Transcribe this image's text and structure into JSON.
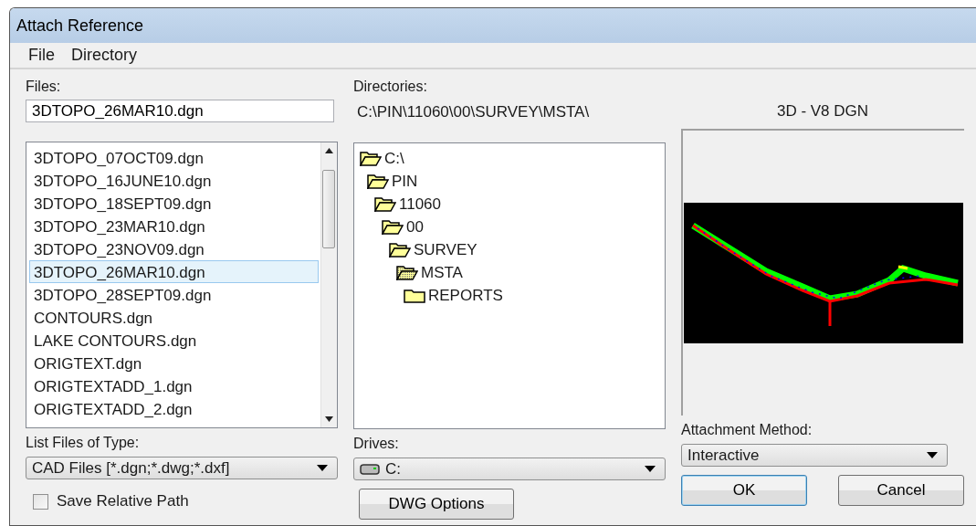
{
  "window": {
    "title": "Attach Reference"
  },
  "menu": [
    {
      "label": "File"
    },
    {
      "label": "Directory"
    }
  ],
  "files": {
    "label": "Files:",
    "value": "3DTOPO_26MAR10.dgn",
    "items": [
      {
        "name": "3DTOPO_07OCT09.dgn",
        "selected": false
      },
      {
        "name": "3DTOPO_16JUNE10.dgn",
        "selected": false
      },
      {
        "name": "3DTOPO_18SEPT09.dgn",
        "selected": false
      },
      {
        "name": "3DTOPO_23MAR10.dgn",
        "selected": false
      },
      {
        "name": "3DTOPO_23NOV09.dgn",
        "selected": false
      },
      {
        "name": "3DTOPO_26MAR10.dgn",
        "selected": true
      },
      {
        "name": "3DTOPO_28SEPT09.dgn",
        "selected": false
      },
      {
        "name": "CONTOURS.dgn",
        "selected": false
      },
      {
        "name": "LAKE CONTOURS.dgn",
        "selected": false
      },
      {
        "name": "ORIGTEXT.dgn",
        "selected": false
      },
      {
        "name": "ORIGTEXTADD_1.dgn",
        "selected": false
      },
      {
        "name": "ORIGTEXTADD_2.dgn",
        "selected": false
      }
    ]
  },
  "directories": {
    "label": "Directories:",
    "path": "C:\\PIN\\11060\\00\\SURVEY\\MSTA\\",
    "tree": [
      {
        "name": "C:\\",
        "kind": "open",
        "children": [
          {
            "name": "PIN",
            "kind": "open",
            "children": [
              {
                "name": "11060",
                "kind": "open",
                "children": [
                  {
                    "name": "00",
                    "kind": "open",
                    "children": [
                      {
                        "name": "SURVEY",
                        "kind": "open",
                        "children": [
                          {
                            "name": "MSTA",
                            "kind": "current",
                            "children": [
                              {
                                "name": "REPORTS",
                                "kind": "closed"
                              }
                            ]
                          }
                        ]
                      }
                    ]
                  }
                ]
              }
            ]
          }
        ]
      }
    ]
  },
  "preview": {
    "title": "3D - V8 DGN"
  },
  "file_type": {
    "label": "List Files of Type:",
    "value": "CAD Files [*.dgn;*.dwg;*.dxf]"
  },
  "drives": {
    "label": "Drives:",
    "value": "C:"
  },
  "attachment_method": {
    "label": "Attachment Method:",
    "value": "Interactive"
  },
  "save_relative_path": {
    "label": "Save Relative Path",
    "checked": false
  },
  "buttons": [
    {
      "label": "DWG Options",
      "default": false
    },
    {
      "label": "OK",
      "default": true
    },
    {
      "label": "Cancel",
      "default": false
    }
  ]
}
